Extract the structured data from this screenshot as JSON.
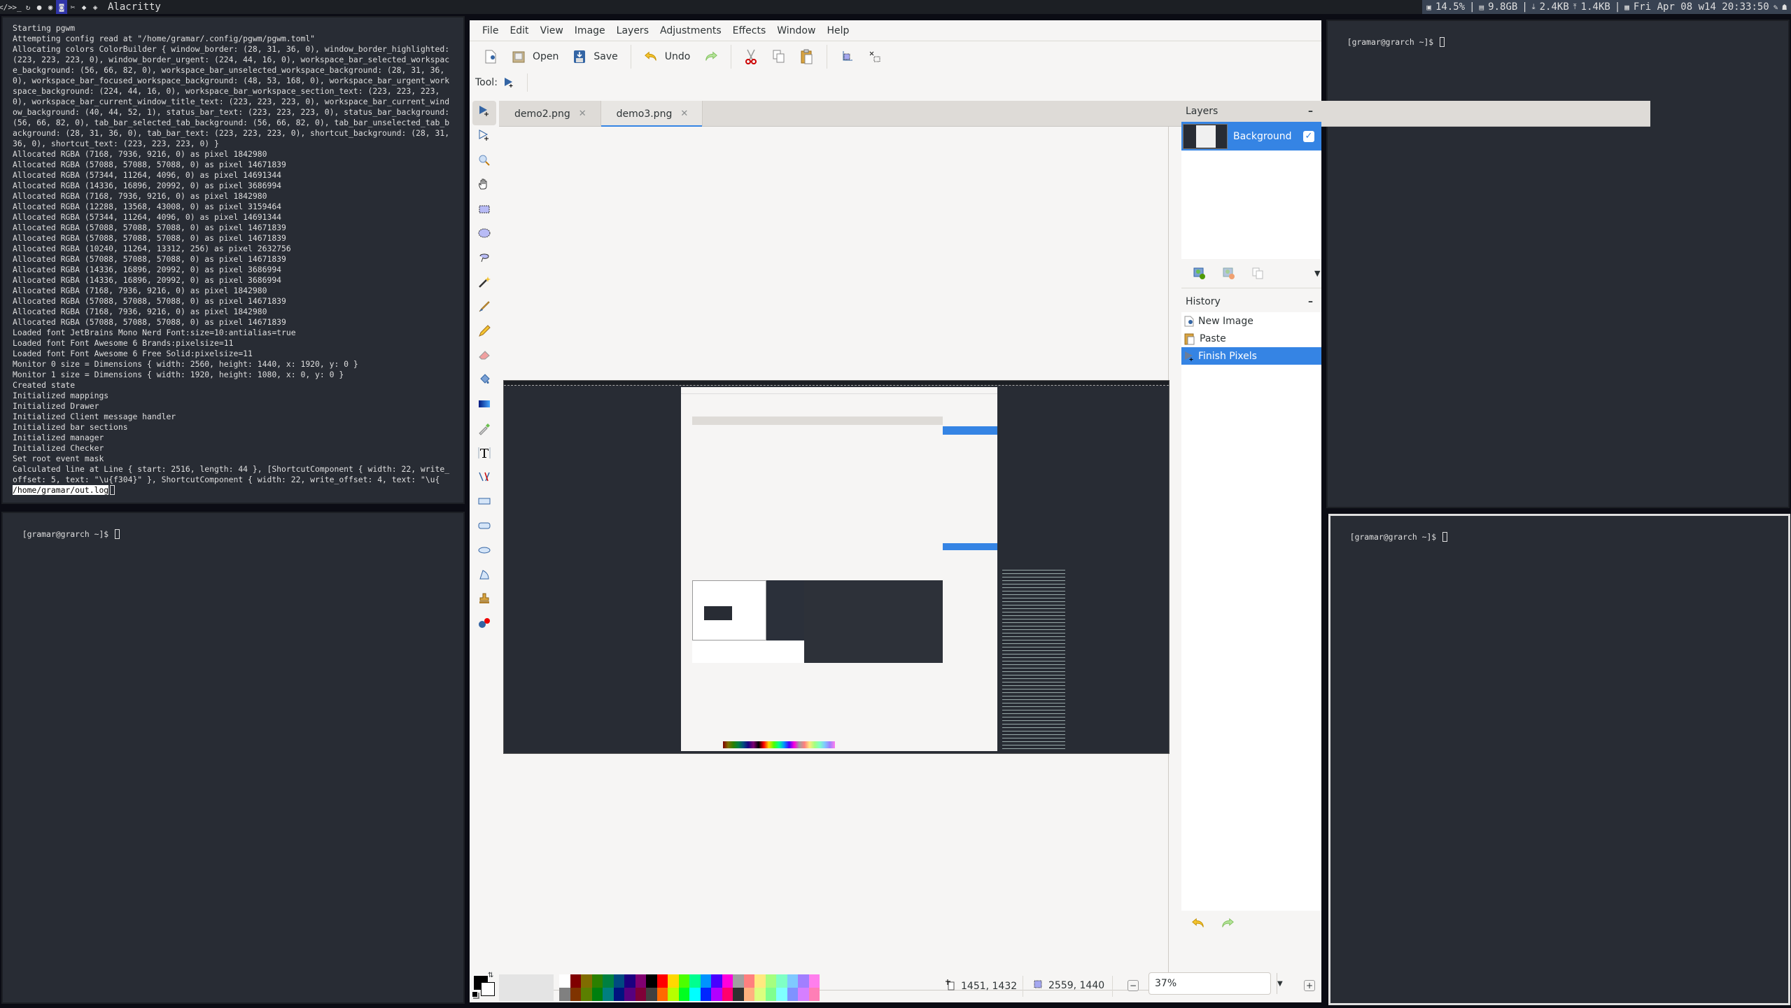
{
  "topbar": {
    "workspaces": [
      {
        "icon": "code-icon",
        "glyph": "</>"
      },
      {
        "icon": "terminal-icon",
        "glyph": ">_"
      },
      {
        "icon": "refresh-icon",
        "glyph": "↻"
      },
      {
        "icon": "chat-icon",
        "glyph": "●"
      },
      {
        "icon": "spotify-icon",
        "glyph": "◉"
      },
      {
        "icon": "discord-icon",
        "glyph": "◙"
      },
      {
        "icon": "tools-icon",
        "glyph": "✂"
      },
      {
        "icon": "tag-icon",
        "glyph": "◆"
      },
      {
        "icon": "tags-icon",
        "glyph": "◈"
      }
    ],
    "focused_workspace": 5,
    "window_title": "Alacritty",
    "status": {
      "cpu": "14.5%",
      "mem": "9.8GB",
      "net_down": "2.4KB",
      "net_up": "1.4KB",
      "datetime": "Fri Apr 08 w14 20:33:50"
    }
  },
  "terminals": {
    "left_top": {
      "lines": [
        "Starting pgwm",
        "Attempting config read at \"/home/gramar/.config/pgwm/pgwm.toml\"",
        "Allocating colors ColorBuilder { window_border: (28, 31, 36, 0), window_border_highlighted: (223, 223, 223, 0), window_border_urgent: (224, 44, 16, 0), workspace_bar_selected_workspace_background: (56, 66, 82, 0), workspace_bar_unselected_workspace_background: (28, 31, 36, 0), workspace_bar_focused_workspace_background: (48, 53, 168, 0), workspace_bar_urgent_workspace_background: (224, 44, 16, 0), workspace_bar_workspace_section_text: (223, 223, 223, 0), workspace_bar_current_window_title_text: (223, 223, 223, 0), workspace_bar_current_window_background: (40, 44, 52, 1), status_bar_text: (223, 223, 223, 0), status_bar_background: (56, 66, 82, 0), tab_bar_selected_tab_background: (56, 66, 82, 0), tab_bar_unselected_tab_background: (28, 31, 36, 0), tab_bar_text: (223, 223, 223, 0), shortcut_background: (28, 31, 36, 0), shortcut_text: (223, 223, 223, 0) }",
        "Allocated RGBA (7168, 7936, 9216, 0) as pixel 1842980",
        "Allocated RGBA (57088, 57088, 57088, 0) as pixel 14671839",
        "Allocated RGBA (57344, 11264, 4096, 0) as pixel 14691344",
        "Allocated RGBA (14336, 16896, 20992, 0) as pixel 3686994",
        "Allocated RGBA (7168, 7936, 9216, 0) as pixel 1842980",
        "Allocated RGBA (12288, 13568, 43008, 0) as pixel 3159464",
        "Allocated RGBA (57344, 11264, 4096, 0) as pixel 14691344",
        "Allocated RGBA (57088, 57088, 57088, 0) as pixel 14671839",
        "Allocated RGBA (57088, 57088, 57088, 0) as pixel 14671839",
        "Allocated RGBA (10240, 11264, 13312, 256) as pixel 2632756",
        "Allocated RGBA (57088, 57088, 57088, 0) as pixel 14671839",
        "Allocated RGBA (14336, 16896, 20992, 0) as pixel 3686994",
        "Allocated RGBA (14336, 16896, 20992, 0) as pixel 3686994",
        "Allocated RGBA (7168, 7936, 9216, 0) as pixel 1842980",
        "Allocated RGBA (57088, 57088, 57088, 0) as pixel 14671839",
        "Allocated RGBA (7168, 7936, 9216, 0) as pixel 1842980",
        "Allocated RGBA (57088, 57088, 57088, 0) as pixel 14671839",
        "Loaded font JetBrains Mono Nerd Font:size=10:antialias=true",
        "Loaded font Font Awesome 6 Brands:pixelsize=11",
        "Loaded font Font Awesome 6 Free Solid:pixelsize=11",
        "Monitor 0 size = Dimensions { width: 2560, height: 1440, x: 1920, y: 0 }",
        "Monitor 1 size = Dimensions { width: 1920, height: 1080, x: 0, y: 0 }",
        "Created state",
        "Initialized mappings",
        "Initialized Drawer",
        "Initialized Client message handler",
        "Initialized bar sections",
        "Initialized manager",
        "Initialized Checker",
        "Set root event mask",
        "Calculated line at Line { start: 2516, length: 44 }, [ShortcutComponent { width: 22, write_offset: 5, text: \"\\u{f304}\" }, ShortcutComponent { width: 22, write_offset: 4, text: \"\\u{"
      ],
      "selected_text": "/home/gramar/out.log"
    },
    "left_bottom": {
      "prompt": "[gramar@grarch ~]$ "
    },
    "right_top": {
      "prompt": "[gramar@grarch ~]$ "
    },
    "right_bottom": {
      "prompt": "[gramar@grarch ~]$ "
    }
  },
  "pinta": {
    "menu": [
      "File",
      "Edit",
      "View",
      "Image",
      "Layers",
      "Adjustments",
      "Effects",
      "Window",
      "Help"
    ],
    "toolbar": {
      "open_label": "Open",
      "save_label": "Save",
      "undo_label": "Undo"
    },
    "tool_label": "Tool:",
    "tools": [
      "move-selected-icon",
      "move-selection-icon",
      "zoom-icon",
      "pan-icon",
      "rectangle-select-icon",
      "ellipse-select-icon",
      "lasso-select-icon",
      "magic-wand-icon",
      "paintbrush-icon",
      "pencil-icon",
      "eraser-icon",
      "paint-bucket-icon",
      "gradient-icon",
      "color-picker-icon",
      "text-icon",
      "line-curve-icon",
      "rectangle-icon",
      "rounded-rectangle-icon",
      "ellipse-icon",
      "freeform-shape-icon",
      "clone-stamp-icon",
      "recolor-icon"
    ],
    "tabs": [
      {
        "label": "demo2.png",
        "active": false
      },
      {
        "label": "demo3.png",
        "active": true
      }
    ],
    "layers": {
      "title": "Layers",
      "items": [
        {
          "name": "Background",
          "visible": true
        }
      ]
    },
    "history": {
      "title": "History",
      "items": [
        {
          "label": "New Image",
          "icon": "new-image-icon"
        },
        {
          "label": "Paste",
          "icon": "paste-icon"
        },
        {
          "label": "Finish Pixels",
          "icon": "move-selected-icon",
          "selected": true
        }
      ]
    },
    "palette": {
      "row1": [
        "#ffffff",
        "#800000",
        "#806c00",
        "#2b8000",
        "#008040",
        "#004a80",
        "#1c0080",
        "#800070",
        "#000000",
        "#ff0000",
        "#ffd800",
        "#4cff00",
        "#00ff90",
        "#0094ff",
        "#4800ff",
        "#ff00dc",
        "#a0a0a0",
        "#ff7f7f",
        "#ffe97f",
        "#a5ff7f",
        "#7fffc5",
        "#7fc9ff",
        "#a17fff",
        "#ff7fed"
      ],
      "row2": [
        "#808080",
        "#7f3300",
        "#5b7f00",
        "#007f0e",
        "#007f7f",
        "#00137f",
        "#57007f",
        "#7f0037",
        "#404040",
        "#ff6a00",
        "#b6ff00",
        "#00ff21",
        "#00ffff",
        "#0026ff",
        "#b200ff",
        "#ff006e",
        "#303030",
        "#ffb27f",
        "#daff7f",
        "#7fff8e",
        "#7fffff",
        "#7f92ff",
        "#d67fff",
        "#ff7fb6"
      ]
    },
    "primary_color": "#000000",
    "secondary_color": "#ffffff",
    "status": {
      "cursor_position": "1451, 1432",
      "selection_size": "2559, 1440",
      "zoom": "37%"
    }
  }
}
